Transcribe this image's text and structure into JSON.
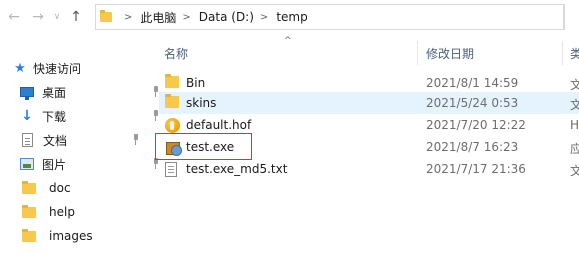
{
  "nav": {
    "back_glyph": "←",
    "forward_glyph": "→",
    "recent_glyph": "∨",
    "up_glyph": "↑"
  },
  "address": {
    "segments": [
      "此电脑",
      "Data (D:)",
      "temp"
    ],
    "separator": ">"
  },
  "sidebar": {
    "quick_access": "快速访问",
    "items": [
      {
        "label": "桌面",
        "icon": "desktop-icon",
        "pinned": true
      },
      {
        "label": "下载",
        "icon": "download-icon",
        "pinned": true
      },
      {
        "label": "文档",
        "icon": "document-icon",
        "pinned": true
      },
      {
        "label": "图片",
        "icon": "pictures-icon",
        "pinned": true
      },
      {
        "label": "doc",
        "icon": "folder-icon",
        "pinned": false
      },
      {
        "label": "help",
        "icon": "folder-icon",
        "pinned": false
      },
      {
        "label": "images",
        "icon": "folder-icon",
        "pinned": false
      }
    ]
  },
  "list": {
    "sort_indicator": "^",
    "columns": [
      "名称",
      "修改日期",
      "类"
    ],
    "files": [
      {
        "name": "Bin",
        "modified": "2021/8/1 14:59",
        "type": "文",
        "icon": "folder-icon"
      },
      {
        "name": "skins",
        "modified": "2021/5/24 0:53",
        "type": "文",
        "icon": "folder-icon"
      },
      {
        "name": "default.hof",
        "modified": "2021/7/20 12:22",
        "type": "H",
        "icon": "hof-file-icon"
      },
      {
        "name": "test.exe",
        "modified": "2021/8/7 16:23",
        "type": "应",
        "icon": "exe-file-icon"
      },
      {
        "name": "test.exe_md5.txt",
        "modified": "2021/7/17 21:36",
        "type": "文",
        "icon": "text-file-icon"
      }
    ]
  },
  "colors": {
    "hover_row": "#e5f3ff",
    "highlight_box": "#d9332b",
    "folder": "#f6c94d",
    "accent": "#2b7de9"
  }
}
